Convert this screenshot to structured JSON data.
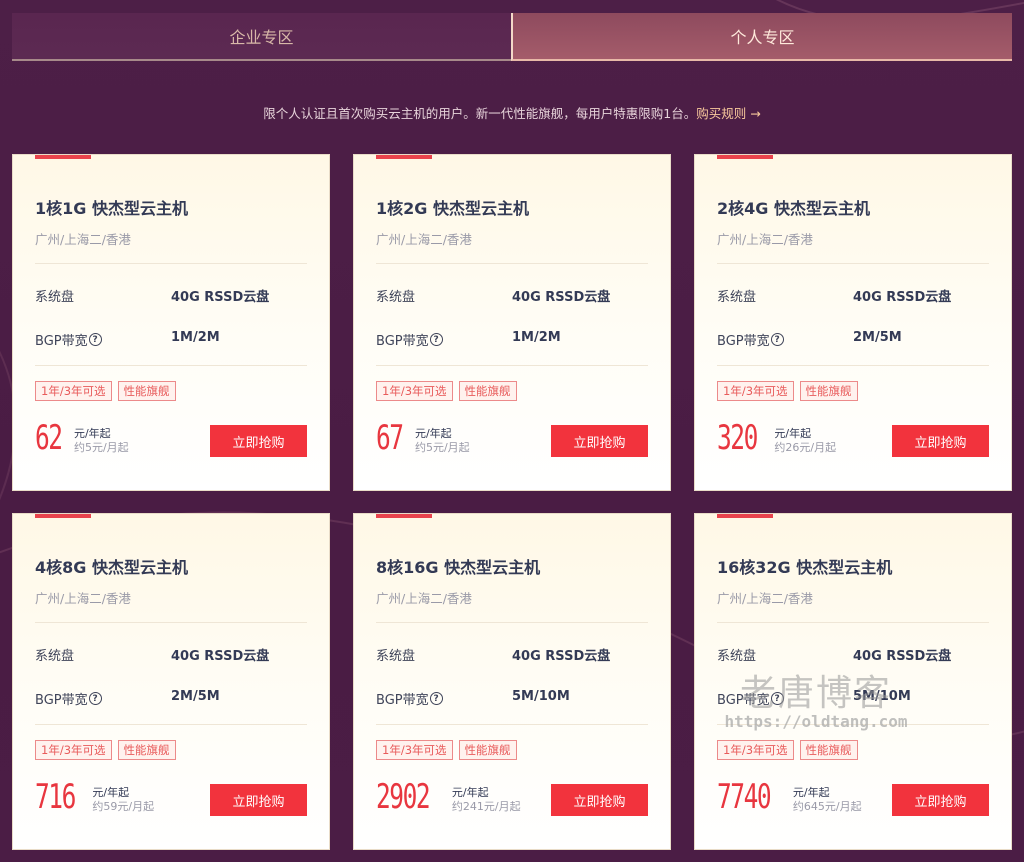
{
  "tabs": [
    {
      "label": "企业专区",
      "active": false
    },
    {
      "label": "个人专区",
      "active": true
    }
  ],
  "notice": {
    "text": "限个人认证且首次购买云主机的用户。新一代性能旗舰，每用户特惠限购1台。",
    "link": "购买规则 →"
  },
  "common": {
    "region": "广州/上海二/香港",
    "disk_label": "系统盘",
    "disk_value": "40G RSSD云盘",
    "bw_label": "BGP带宽",
    "tag1": "1年/3年可选",
    "tag2": "性能旗舰",
    "unit": "元/年起",
    "buy": "立即抢购",
    "help_glyph": "?"
  },
  "cards": [
    {
      "title": "1核1G 快杰型云主机",
      "bw": "1M/2M",
      "price": "62",
      "monthly": "约5元/月起"
    },
    {
      "title": "1核2G 快杰型云主机",
      "bw": "1M/2M",
      "price": "67",
      "monthly": "约5元/月起"
    },
    {
      "title": "2核4G 快杰型云主机",
      "bw": "2M/5M",
      "price": "320",
      "monthly": "约26元/月起"
    },
    {
      "title": "4核8G 快杰型云主机",
      "bw": "2M/5M",
      "price": "716",
      "monthly": "约59元/月起"
    },
    {
      "title": "8核16G 快杰型云主机",
      "bw": "5M/10M",
      "price": "2902",
      "monthly": "约241元/月起"
    },
    {
      "title": "16核32G 快杰型云主机",
      "bw": "5M/10M",
      "price": "7740",
      "monthly": "约645元/月起"
    }
  ],
  "watermark": {
    "cn": "老唐博客",
    "url": "https://oldtang.com"
  },
  "colors": {
    "accent": "#f2333d",
    "background": "#4a1d45"
  }
}
